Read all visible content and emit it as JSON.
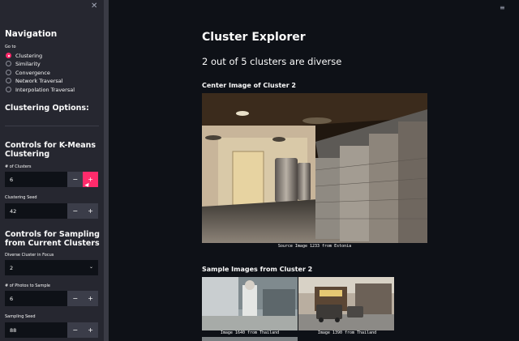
{
  "sidebar": {
    "close_glyph": "✕",
    "nav_title": "Navigation",
    "goto_label": "Go to",
    "nav_items": [
      {
        "label": "Clustering",
        "selected": true
      },
      {
        "label": "Similarity",
        "selected": false
      },
      {
        "label": "Convergence",
        "selected": false
      },
      {
        "label": "Network Traversal",
        "selected": false
      },
      {
        "label": "Interpolation Traversal",
        "selected": false
      }
    ],
    "clustering_options_title": "Clustering Options:",
    "kmeans_title": "Controls for K-Means Clustering",
    "num_clusters_label": "# of Clusters",
    "num_clusters_value": "6",
    "clustering_seed_label": "Clustering Seed",
    "clustering_seed_value": "42",
    "sampling_title": "Controls for Sampling from Current Clusters",
    "diverse_cluster_label": "Diverse Cluster in Focus",
    "diverse_cluster_value": "2",
    "num_photos_label": "# of Photos to Sample",
    "num_photos_value": "6",
    "sampling_seed_label": "Sampling Seed",
    "sampling_seed_value": "88",
    "minus": "−",
    "plus": "+"
  },
  "main": {
    "title": "Cluster Explorer",
    "subtitle": "2 out of 5 clusters are diverse",
    "center_title": "Center Image of Cluster 2",
    "center_caption": "Source Image 1233 from Estonia",
    "samples_title": "Sample Images from Cluster 2",
    "samples": [
      {
        "caption": "Image 1640 from Thailand"
      },
      {
        "caption": "Image 1390 from Thailand"
      }
    ]
  },
  "colors": {
    "accent": "#ff2b6b",
    "sidebar_bg": "#262730",
    "main_bg": "#0e1117"
  }
}
